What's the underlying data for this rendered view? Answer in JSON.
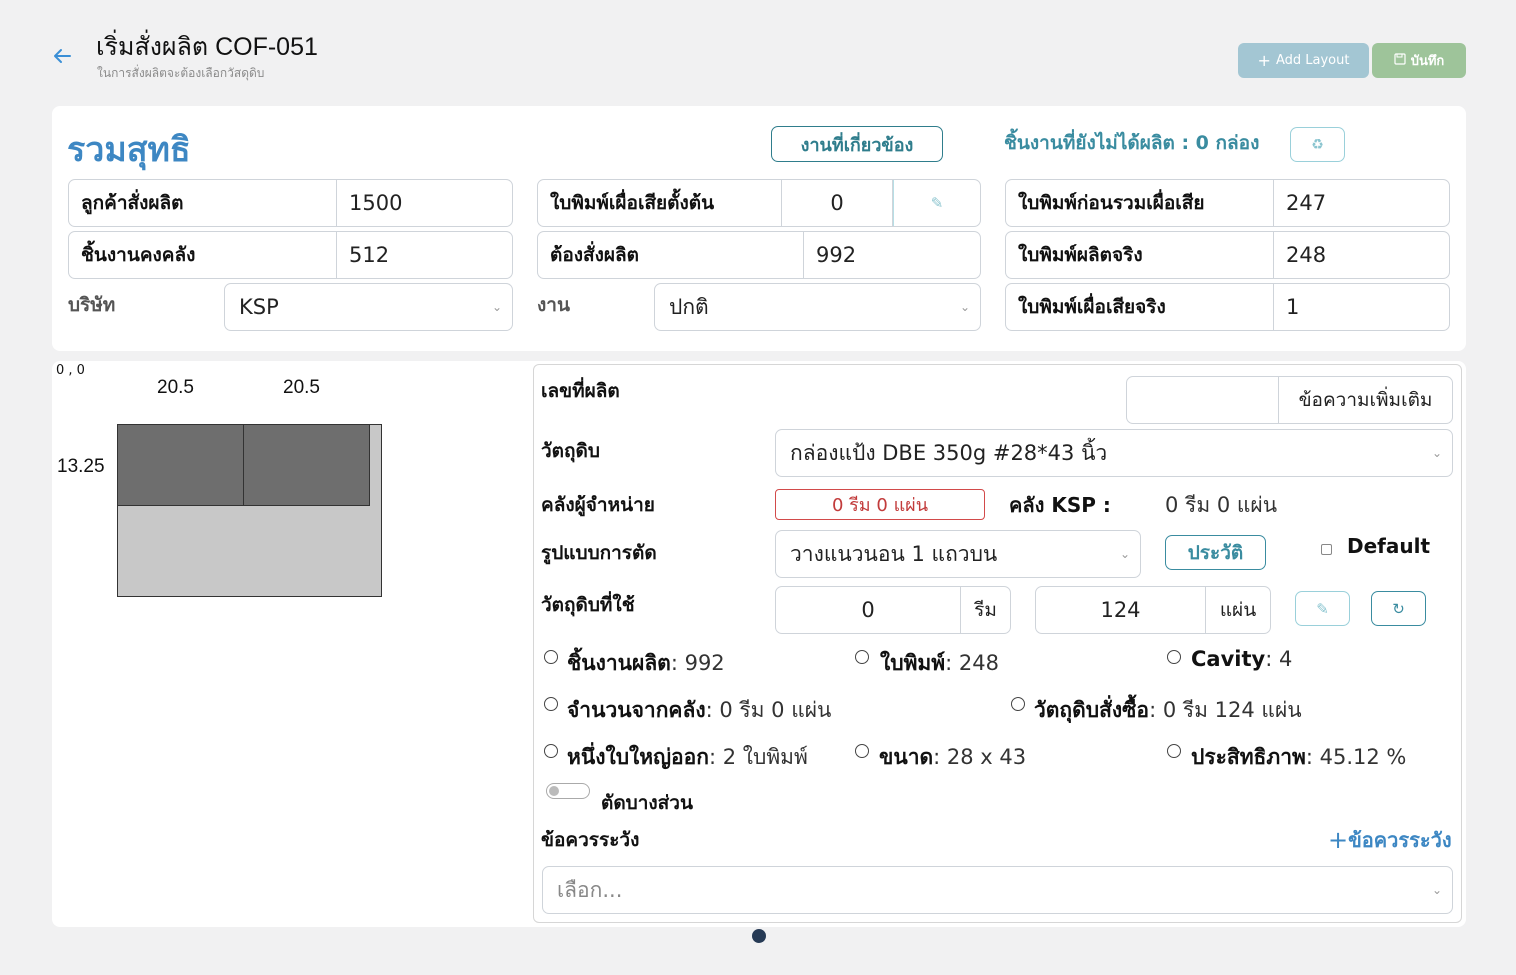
{
  "header": {
    "title": "เริ่มสั่งผลิต COF-051",
    "subtitle": "ในการสั่งผลิตจะต้องเลือกวัสดุดิบ",
    "add_layout_label": "Add Layout",
    "save_label": "บันทึก"
  },
  "summary": {
    "title": "รวมสุทธิ",
    "related_button": "งานที่เกี่ยวข้อง",
    "unproduced_text": "ชิ้นงานที่ยังไม่ได้ผลิต : 0 กล่อง",
    "fields": {
      "customer_order": {
        "label": "ลูกค้าสั่งผลิต",
        "value": "1500"
      },
      "stock_pieces": {
        "label": "ชิ้นงานคงคลัง",
        "value": "512"
      },
      "initial_waste": {
        "label": "ใบพิมพ์เผื่อเสียตั้งต้น",
        "value": "0"
      },
      "must_order": {
        "label": "ต้องสั่งผลิต",
        "value": "992"
      },
      "prints_before_waste": {
        "label": "ใบพิมพ์ก่อนรวมเผื่อเสีย",
        "value": "247"
      },
      "actual_prints": {
        "label": "ใบพิมพ์ผลิตจริง",
        "value": "248"
      },
      "actual_waste": {
        "label": "ใบพิมพ์เผื่อเสียจริง",
        "value": "1"
      }
    },
    "company": {
      "label": "บริษัท",
      "value": "KSP"
    },
    "job": {
      "label": "งาน",
      "value": "ปกติ"
    }
  },
  "layout_preview": {
    "origin": "0 , 0",
    "widths": [
      "20.5",
      "20.5"
    ],
    "height": "13.25"
  },
  "detail": {
    "production_no_label": "เลขที่ผลิต",
    "extra_message_button": "ข้อความเพิ่มเติม",
    "material_label": "วัตถุดิบ",
    "material_value": "กล่องแป้ง DBE 350g #28*43 นิ้ว",
    "supplier_stock_label": "คลังผู้จำหน่าย",
    "supplier_stock_value": "0 รีม 0 แผ่น",
    "ksp_stock_label": "คลัง KSP :",
    "ksp_stock_value": "0 รีม 0 แผ่น",
    "cut_pattern_label": "รูปแบบการตัด",
    "cut_pattern_value": "วางแนวนอน 1 แถวบน",
    "history_button": "ประวัติ",
    "default_label": "Default",
    "material_used_label": "วัตถุดิบที่ใช้",
    "ream_value": "0",
    "ream_unit": "รีม",
    "sheet_value": "124",
    "sheet_unit": "แผ่น",
    "stats": {
      "pieces_label": "ชิ้นงานผลิต",
      "pieces_value": ": 992",
      "prints_label": "ใบพิมพ์",
      "prints_value": ": 248",
      "cavity_label": "Cavity",
      "cavity_value": ": 4",
      "from_stock_label": "จำนวนจากคลัง",
      "from_stock_value": ": 0 รีม 0 แผ่น",
      "purchase_label": "วัตถุดิบสั่งซื้อ",
      "purchase_value": ": 0 รีม 124 แผ่น",
      "per_sheet_label": "หนึ่งใบใหญ่ออก",
      "per_sheet_value": ": 2 ใบพิมพ์",
      "size_label": "ขนาด",
      "size_value": ": 28 x 43",
      "efficiency_label": "ประสิทธิภาพ",
      "efficiency_value": ": 45.12 %"
    },
    "partial_cut_label": "ตัดบางส่วน",
    "caution_label": "ข้อควรระวัง",
    "add_caution_button": "ข้อควรระวัง",
    "caution_placeholder": "เลือก..."
  }
}
